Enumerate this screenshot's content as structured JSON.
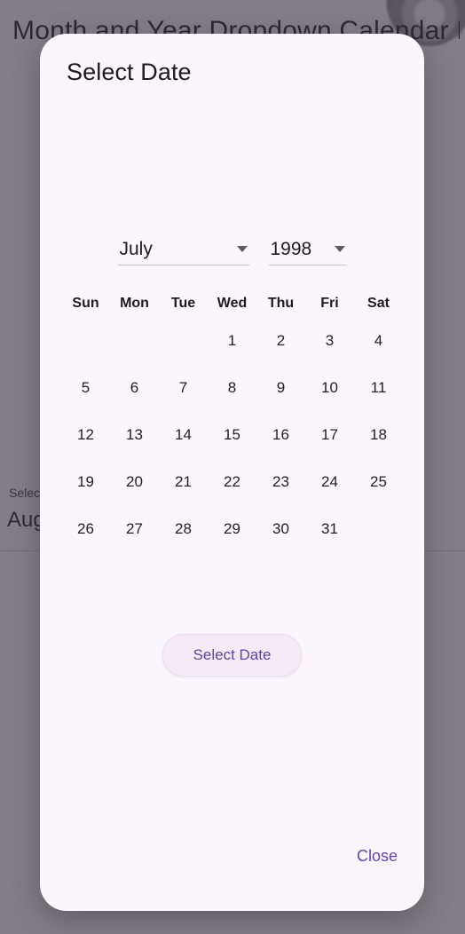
{
  "background": {
    "app_title": "Month and Year Dropdown Calendar Ex...",
    "selected_label": "Selec",
    "selected_value": "Aug"
  },
  "dialog": {
    "title": "Select Date",
    "month_select": {
      "value": "July",
      "caret_icon": "chevron-down-icon"
    },
    "year_select": {
      "value": "1998",
      "caret_icon": "chevron-down-icon"
    },
    "weekdays": [
      "Sun",
      "Mon",
      "Tue",
      "Wed",
      "Thu",
      "Fri",
      "Sat"
    ],
    "weeks": [
      [
        "",
        "",
        "",
        "1",
        "2",
        "3",
        "4"
      ],
      [
        "5",
        "6",
        "7",
        "8",
        "9",
        "10",
        "11"
      ],
      [
        "12",
        "13",
        "14",
        "15",
        "16",
        "17",
        "18"
      ],
      [
        "19",
        "20",
        "21",
        "22",
        "23",
        "24",
        "25"
      ],
      [
        "26",
        "27",
        "28",
        "29",
        "30",
        "31",
        ""
      ]
    ],
    "confirm_label": "Select Date",
    "close_label": "Close"
  },
  "colors": {
    "accent": "#6246b5",
    "button_bg": "#f6eaf6",
    "sheet_bg": "#faf6fb",
    "scrim": "rgba(60,54,64,0.62)"
  }
}
